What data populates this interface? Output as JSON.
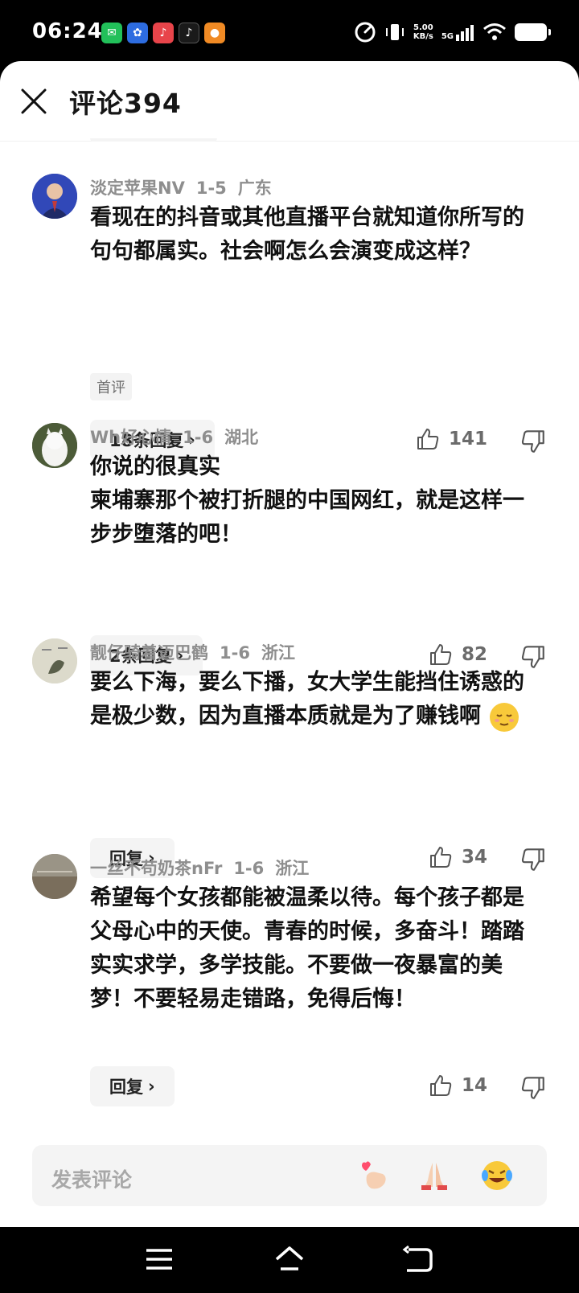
{
  "status_bar": {
    "time": "06:24",
    "net_speed_value": "5.00",
    "net_speed_unit": "KB/s",
    "network": "5G",
    "apps": [
      {
        "icon": "wechat-icon",
        "color": "#22c05a",
        "glyph": "✉"
      },
      {
        "icon": "baidu-icon",
        "color": "#2d6ce0",
        "glyph": "✿"
      },
      {
        "icon": "app-red-icon",
        "color": "#e8444a",
        "glyph": "♪"
      },
      {
        "icon": "tiktok-icon",
        "color": "#1a1a1a",
        "glyph": "♪"
      },
      {
        "icon": "app-orange-icon",
        "color": "#f08a24",
        "glyph": "●"
      }
    ]
  },
  "header": {
    "title": "评论394"
  },
  "comments": [
    {
      "user": "淡定苹果NV",
      "date": "1-5",
      "location": "广东",
      "text": "看现在的抖音或其他直播平台就知道你所写的句句都属实。社会啊怎么会演变成这样？",
      "badge": "首评",
      "reply_label": "18条回复",
      "likes": "141"
    },
    {
      "user": "Wh好心情",
      "date": "1-6",
      "location": "湖北",
      "text_line1": "你说的很真实",
      "text_line2": "柬埔寨那个被打折腿的中国网红，就是这样一步步堕落的吧！",
      "reply_label": "2条回复",
      "likes": "82"
    },
    {
      "user": "靓仔骑着迈巴鹤",
      "date": "1-6",
      "location": "浙江",
      "text": "要么下海，要么下播，女大学生能挡住诱惑的是极少数，因为直播本质就是为了赚钱啊",
      "reply_label": "回复",
      "likes": "34"
    },
    {
      "user": "一丝不苟奶茶nFr",
      "date": "1-6",
      "location": "浙江",
      "text": "希望每个女孩都能被温柔以待。每个孩子都是父母心中的天使。青春的时候，多奋斗！踏踏实实求学，多学技能。不要做一夜暴富的美梦！不要轻易走错路，免得后悔！",
      "reply_label": "回复",
      "likes": "14"
    }
  ],
  "input": {
    "placeholder": "发表评论"
  }
}
